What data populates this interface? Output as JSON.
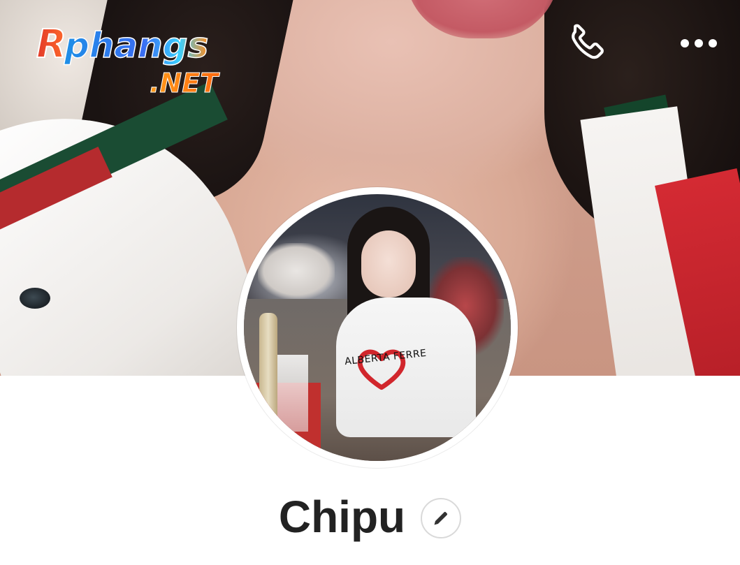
{
  "watermark": {
    "brand": "Rphangs",
    "suffix": ".NET"
  },
  "header_actions": {
    "call_icon": "phone-icon",
    "more_icon": "more-horizontal-icon"
  },
  "profile": {
    "name": "Chipu",
    "edit_icon": "pencil-icon",
    "shirt_print": "ALBERTA FERRE"
  },
  "colors": {
    "name_text": "#222222",
    "icon_white": "#ffffff",
    "heart_red": "#d1262c"
  }
}
